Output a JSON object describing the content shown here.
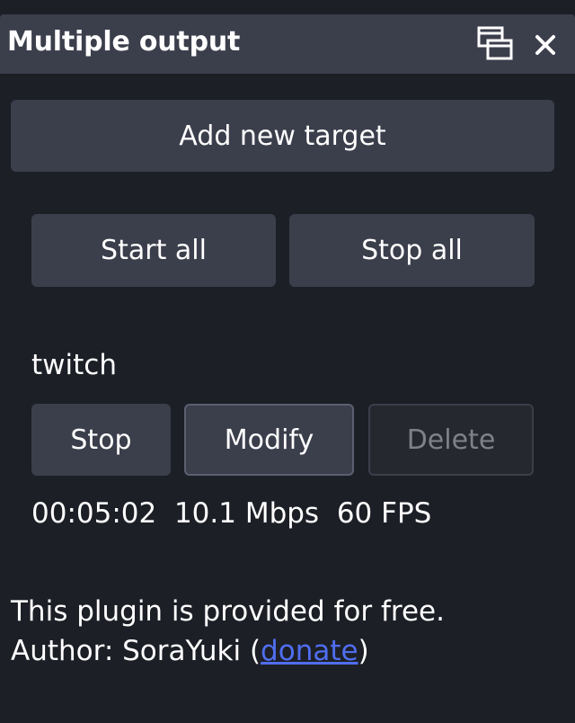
{
  "window": {
    "title": "Multiple output",
    "float_icon": "float-window-icon",
    "close_icon": "close-icon"
  },
  "controls": {
    "add_label": "Add new target",
    "start_all_label": "Start all",
    "stop_all_label": "Stop all"
  },
  "targets": [
    {
      "name": "twitch",
      "stop_label": "Stop",
      "modify_label": "Modify",
      "delete_label": "Delete",
      "delete_enabled": false,
      "duration": "00:05:02",
      "bitrate": "10.1 Mbps",
      "fps": "60 FPS"
    }
  ],
  "footer": {
    "line1": "This plugin is provided for free.",
    "author_prefix": "Author: SoraYuki (",
    "donate_link": "donate",
    "author_suffix": ")"
  },
  "colors": {
    "background": "#1d1f27",
    "button": "#3b3e4b",
    "button_disabled": "#26282f",
    "link": "#4f6ef0"
  }
}
